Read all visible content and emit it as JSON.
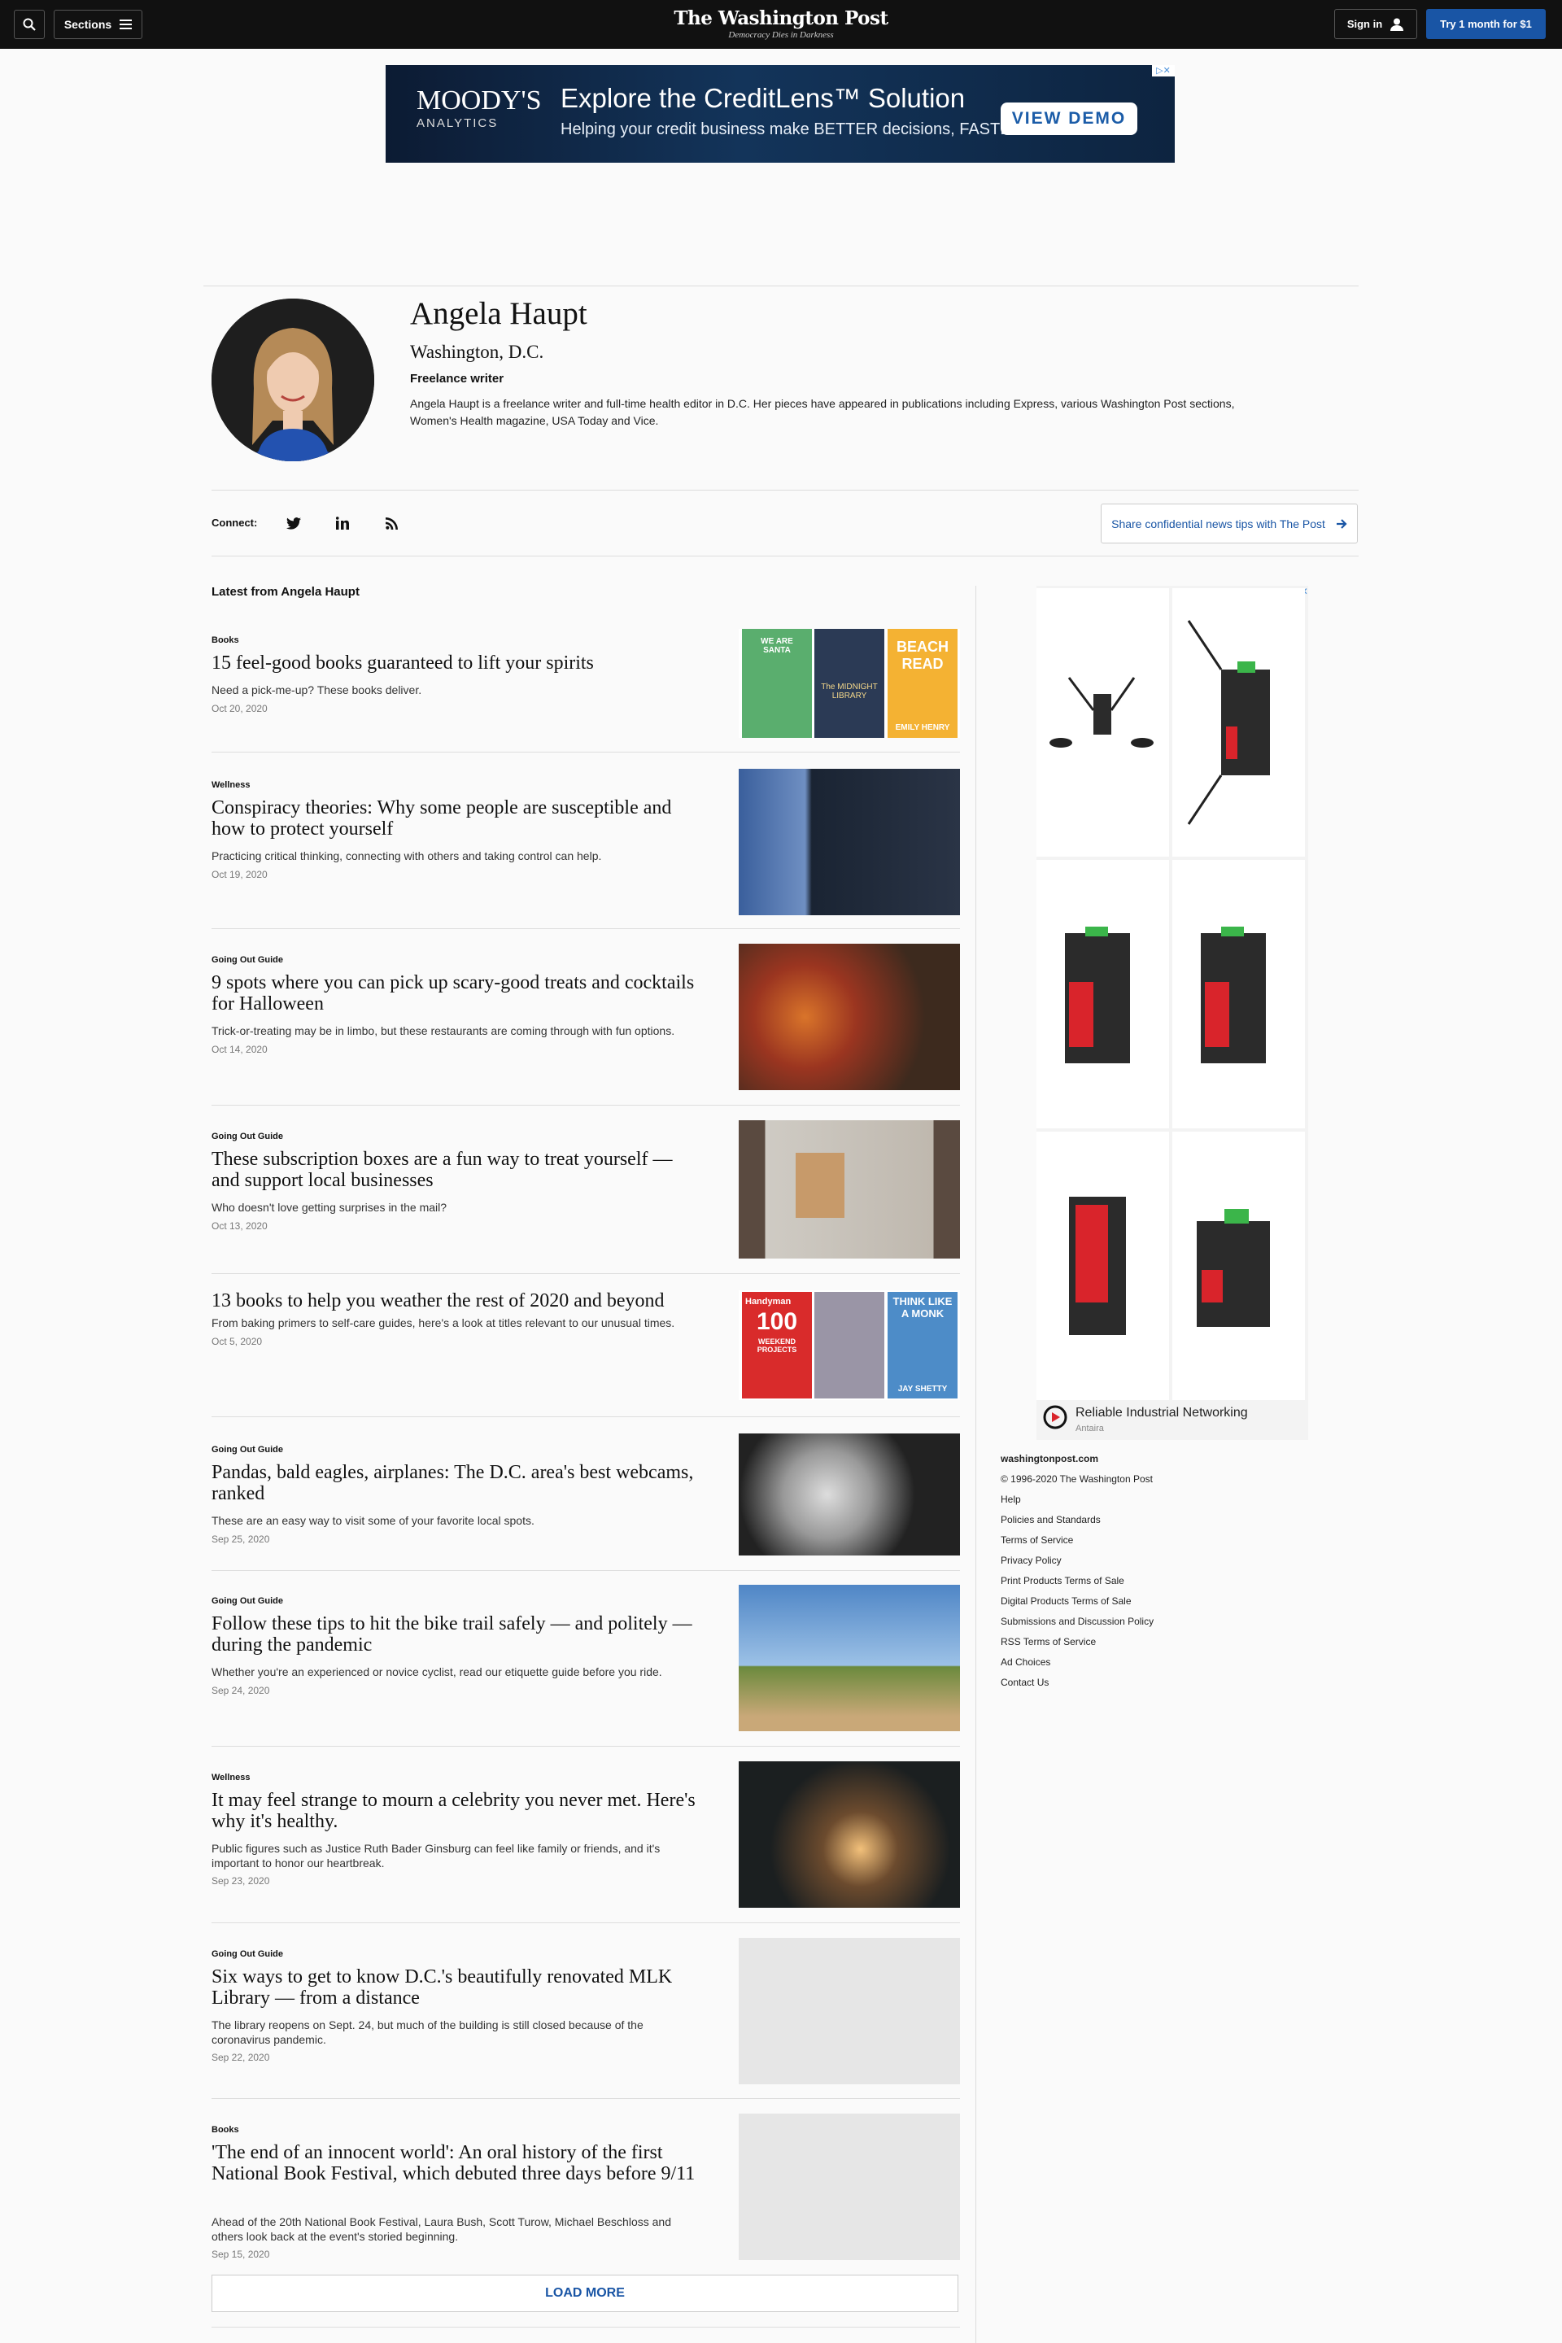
{
  "header": {
    "sections_label": "Sections",
    "logo_name": "The Washington Post",
    "logo_tagline": "Democracy Dies in Darkness",
    "signin_label": "Sign in",
    "try_label": "Try 1 month for $1"
  },
  "top_ad": {
    "brand": "MOODY'S",
    "brand_sub": "ANALYTICS",
    "headline": "Explore the CreditLens™ Solution",
    "subline": "Helping your credit business make BETTER decisions, FASTER",
    "cta": "VIEW DEMO"
  },
  "profile": {
    "name": "Angela Haupt",
    "location": "Washington, D.C.",
    "role": "Freelance writer",
    "bio": "Angela Haupt is a freelance writer and full-time health editor in D.C. Her pieces have appeared in publications including Express, various Washington Post sections, Women's Health magazine, USA Today and Vice."
  },
  "connect": {
    "label": "Connect:",
    "share_label": "Share confidential news tips with The Post"
  },
  "latest_heading": "Latest from Angela Haupt",
  "articles": [
    {
      "kicker": "Books",
      "title": "15 feel-good books guaranteed to lift your spirits",
      "blurb": "Need a pick-me-up? These books deliver.",
      "date": "Oct 20, 2020"
    },
    {
      "kicker": "Wellness",
      "title": "Conspiracy theories: Why some people are susceptible and how to protect yourself",
      "blurb": "Practicing critical thinking, connecting with others and taking control can help.",
      "date": "Oct 19, 2020"
    },
    {
      "kicker": "Going Out Guide",
      "title": "9 spots where you can pick up scary-good treats and cocktails for Halloween",
      "blurb": "Trick-or-treating may be in limbo, but these restaurants are coming through with fun options.",
      "date": "Oct 14, 2020"
    },
    {
      "kicker": "Going Out Guide",
      "title": "These subscription boxes are a fun way to treat yourself — and support local businesses",
      "blurb": "Who doesn't love getting surprises in the mail?",
      "date": "Oct 13, 2020"
    },
    {
      "kicker": "",
      "title": "13 books to help you weather the rest of 2020 and beyond",
      "blurb": "From baking primers to self-care guides, here's a look at titles relevant to our unusual times.",
      "date": "Oct 5, 2020"
    },
    {
      "kicker": "Going Out Guide",
      "title": "Pandas, bald eagles, airplanes: The D.C. area's best webcams, ranked",
      "blurb": "These are an easy way to visit some of your favorite local spots.",
      "date": "Sep 25, 2020"
    },
    {
      "kicker": "Going Out Guide",
      "title": "Follow these tips to hit the bike trail safely — and politely — during the pandemic",
      "blurb": "Whether you're an experienced or novice cyclist, read our etiquette guide before you ride.",
      "date": "Sep 24, 2020"
    },
    {
      "kicker": "Wellness",
      "title": "It may feel strange to mourn a celebrity you never met. Here's why it's healthy.",
      "blurb": "Public figures such as Justice Ruth Bader Ginsburg can feel like family or friends, and it's important to honor our heartbreak.",
      "date": "Sep 23, 2020"
    },
    {
      "kicker": "Going Out Guide",
      "title": "Six ways to get to know D.C.'s beautifully renovated MLK Library — from a distance",
      "blurb": "The library reopens on Sept. 24, but much of the building is still closed because of the coronavirus pandemic.",
      "date": "Sep 22, 2020"
    },
    {
      "kicker": "Books",
      "title": "'The end of an innocent world': An oral history of the first National Book Festival, which debuted three days before 9/11",
      "blurb": "Ahead of the 20th National Book Festival, Laura Bush, Scott Turow, Michael Beschloss and others look back at the event's storied beginning.",
      "date": "Sep 15, 2020"
    }
  ],
  "book_covers": {
    "a1": [
      "WE ARE SANTA",
      "The MIDNIGHT LIBRARY",
      "BEACH READ",
      "EMILY HENRY"
    ],
    "a5": [
      "Handyman",
      "100",
      "WEEKEND PROJECTS",
      "THINK LIKE A MONK",
      "JAY SHETTY"
    ]
  },
  "load_more_label": "LOAD MORE",
  "side_ad": {
    "title": "Reliable Industrial Networking",
    "advertiser": "Antaira"
  },
  "footer": {
    "links": [
      "washingtonpost.com",
      "© 1996-2020 The Washington Post",
      "Help",
      "Policies and Standards",
      "Terms of Service",
      "Privacy Policy",
      "Print Products Terms of Sale",
      "Digital Products Terms of Sale",
      "Submissions and Discussion Policy",
      "RSS Terms of Service",
      "Ad Choices",
      "Contact Us"
    ]
  }
}
